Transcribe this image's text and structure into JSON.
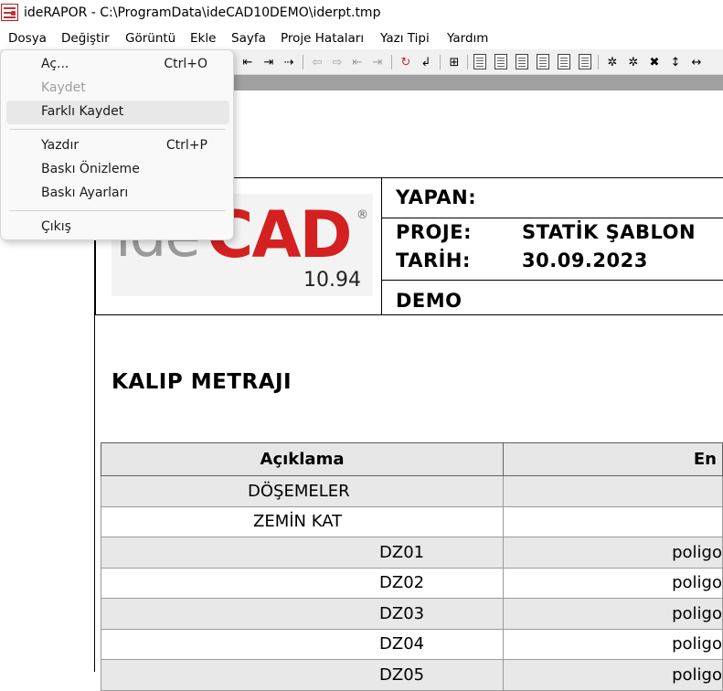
{
  "window": {
    "title": "ideRAPOR - C:\\ProgramData\\ideCAD10DEMO\\iderpt.tmp"
  },
  "menubar": [
    {
      "label": "Dosya"
    },
    {
      "label": "Değiştir"
    },
    {
      "label": "Görüntü"
    },
    {
      "label": "Ekle"
    },
    {
      "label": "Sayfa"
    },
    {
      "label": "Proje Hataları"
    },
    {
      "label": "Yazı Tipi"
    },
    {
      "label": "Yardım"
    }
  ],
  "dosya_menu": {
    "open": {
      "label": "Aç...",
      "shortcut": "Ctrl+O",
      "enabled": true
    },
    "save": {
      "label": "Kaydet",
      "enabled": false
    },
    "save_as": {
      "label": "Farklı Kaydet",
      "enabled": true,
      "highlighted": true
    },
    "print": {
      "label": "Yazdır",
      "shortcut": "Ctrl+P",
      "enabled": true
    },
    "print_preview": {
      "label": "Baskı Önizleme",
      "enabled": true
    },
    "print_settings": {
      "label": "Baskı Ayarları",
      "enabled": true
    },
    "exit": {
      "label": "Çıkış",
      "enabled": true
    }
  },
  "report_header": {
    "yapan_label": "YAPAN:",
    "proje_label": "PROJE:",
    "proje_value": "STATİK ŞABLON",
    "tarih_label": "TARİH:",
    "tarih_value": "30.09.2023",
    "demo_label": "DEMO"
  },
  "logo": {
    "ide": "ide",
    "cad": "CAD",
    "registered": "®",
    "version": "10.94",
    "accent_color": "#d42020"
  },
  "section_title": "KALIP METRAJI",
  "table": {
    "headers": [
      "Açıklama",
      "En"
    ],
    "rows": [
      {
        "desc": "DÖŞEMELER",
        "en": ""
      },
      {
        "desc": "ZEMİN KAT",
        "en": ""
      },
      {
        "desc": "DZ01",
        "en": "poligo"
      },
      {
        "desc": "DZ02",
        "en": "poligo"
      },
      {
        "desc": "DZ03",
        "en": "poligo"
      },
      {
        "desc": "DZ04",
        "en": "poligo"
      },
      {
        "desc": "DZ05",
        "en": "poligo"
      }
    ]
  }
}
